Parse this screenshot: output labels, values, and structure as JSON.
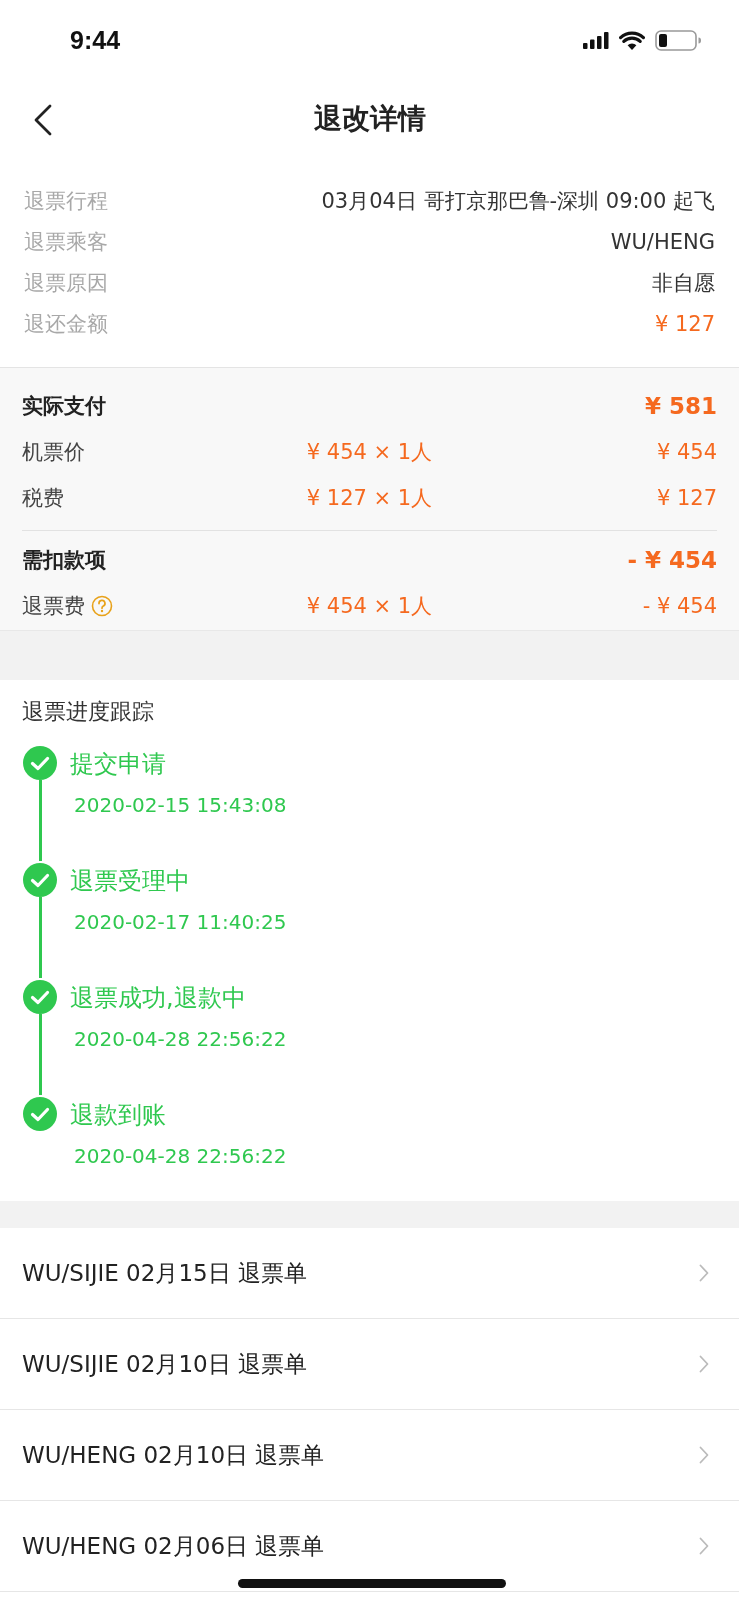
{
  "status_bar": {
    "time": "9:44"
  },
  "nav": {
    "title": "退改详情"
  },
  "refund_info": [
    {
      "label": "退票行程",
      "value": "03月04日 哥打京那巴鲁-深圳 09:00 起飞",
      "kind": "text"
    },
    {
      "label": "退票乘客",
      "value": "WU/HENG",
      "kind": "text"
    },
    {
      "label": "退票原因",
      "value": "非自愿",
      "kind": "text"
    },
    {
      "label": "退还金额",
      "value": "¥ 127",
      "kind": "amount"
    }
  ],
  "payment_groups": [
    {
      "title": "实际支付",
      "total": "¥ 581",
      "items": [
        {
          "label": "机票价",
          "unit": "¥ 454 × 1人",
          "amount": "¥ 454",
          "help": false
        },
        {
          "label": "税费",
          "unit": "¥ 127 × 1人",
          "amount": "¥ 127",
          "help": false
        }
      ]
    },
    {
      "title": "需扣款项",
      "total": "- ¥ 454",
      "items": [
        {
          "label": "退票费",
          "unit": "¥ 454 × 1人",
          "amount": "- ¥ 454",
          "help": true
        }
      ]
    }
  ],
  "tracking": {
    "title": "退票进度跟踪",
    "steps": [
      {
        "label": "提交申请",
        "time": "2020-02-15 15:43:08",
        "done": true
      },
      {
        "label": "退票受理中",
        "time": "2020-02-17 11:40:25",
        "done": true
      },
      {
        "label": "退票成功,退款中",
        "time": "2020-04-28 22:56:22",
        "done": true
      },
      {
        "label": "退款到账",
        "time": "2020-04-28 22:56:22",
        "done": true
      }
    ]
  },
  "orders": [
    {
      "label": "WU/SIJIE 02月15日 退票单"
    },
    {
      "label": "WU/SIJIE 02月10日 退票单"
    },
    {
      "label": "WU/HENG 02月10日 退票单"
    },
    {
      "label": "WU/HENG 02月06日 退票单"
    }
  ]
}
